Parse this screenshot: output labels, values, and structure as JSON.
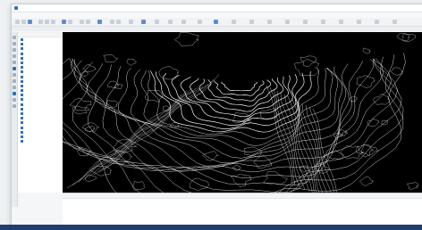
{
  "window": {
    "title": "",
    "menus": [
      "",
      "",
      "",
      "",
      ""
    ]
  },
  "ribbon": {
    "groups": [
      "",
      "",
      "",
      "",
      "",
      ""
    ]
  },
  "layers_panel": {
    "header": "",
    "items": [
      "",
      "",
      "",
      "",
      "",
      "",
      "",
      "",
      "",
      "",
      "",
      "",
      "",
      "",
      "",
      "",
      "",
      "",
      "",
      "",
      "",
      "",
      ""
    ]
  },
  "output_panel": {
    "title": "",
    "lines": [
      "",
      "",
      "",
      "",
      "",
      ""
    ]
  },
  "colors": {
    "accent": "#2f6fb6",
    "viewport_bg": "#000000",
    "contour": "#ffffff",
    "taskbar": "#1e3f6f"
  },
  "icons": [
    "app-icon",
    "tool-icons",
    "layer-checkbox-icon"
  ]
}
